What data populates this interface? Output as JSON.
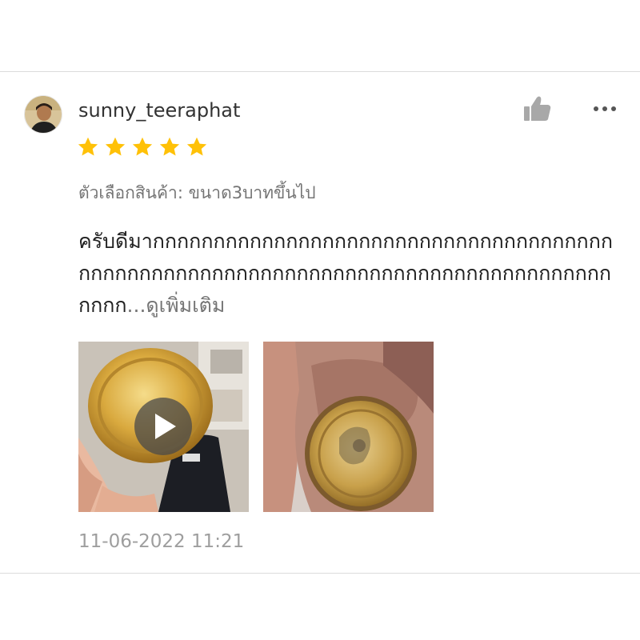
{
  "review": {
    "username": "sunny_teeraphat",
    "rating": 5,
    "star_color": "#ffc107",
    "variation": "ตัวเลือกสินค้า: ขนาด3บาทขึ้นไป",
    "comment": "ครับดีมากกกกกกกกกกกกกกกกกกกกกกกกกกกกกกกกกกกกกกกกกกกกกกกกกกกกกกกกกกกกกกกกกกกกกกกกกกกกกกกกกกกกกก",
    "see_more": "...ดูเพิ่มเติม",
    "timestamp": "11-06-2022 11:21",
    "media": [
      {
        "kind": "video",
        "subject": "gold coin held in hand",
        "icon": "play-icon"
      },
      {
        "kind": "photo",
        "subject": "gold coin in palm"
      }
    ]
  },
  "icons": {
    "like": "thumbs-up-icon",
    "more": "more-icon",
    "star": "star-icon"
  }
}
